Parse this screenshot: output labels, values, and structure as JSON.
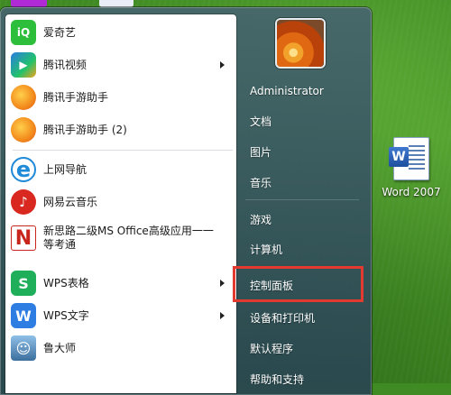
{
  "programs": [
    {
      "label": "爱奇艺",
      "icon": "iqiyi-icon",
      "color": "#2dbe3b",
      "glyph": "iQ",
      "has_submenu": false
    },
    {
      "label": "腾讯视频",
      "icon": "tencent-video-icon",
      "color": "#2a7de1",
      "glyph": "▶",
      "has_submenu": true
    },
    {
      "label": "腾讯手游助手",
      "icon": "tencent-game-assistant-icon",
      "color": "#f28a1c",
      "glyph": "◆",
      "has_submenu": false
    },
    {
      "label": "腾讯手游助手 (2)",
      "icon": "tencent-game-assistant-icon",
      "color": "#f28a1c",
      "glyph": "◆",
      "has_submenu": false
    },
    {
      "label": "上网导航",
      "icon": "ie-browser-icon",
      "color": "#1f8ad8",
      "glyph": "e",
      "has_submenu": false
    },
    {
      "label": "网易云音乐",
      "icon": "netease-music-icon",
      "color": "#d8281f",
      "glyph": "♪",
      "has_submenu": false
    },
    {
      "label": "新思路二级MS Office高级应用一一等考通",
      "icon": "exam-app-icon",
      "color": "#c8261d",
      "glyph": "N",
      "has_submenu": false
    },
    {
      "label": "WPS表格",
      "icon": "wps-sheets-icon",
      "color": "#1fae5a",
      "glyph": "S",
      "has_submenu": true
    },
    {
      "label": "WPS文字",
      "icon": "wps-writer-icon",
      "color": "#2e7de3",
      "glyph": "W",
      "has_submenu": true
    },
    {
      "label": "鲁大师",
      "icon": "ludashi-icon",
      "color": "#3d6f9d",
      "glyph": "☺",
      "has_submenu": false
    }
  ],
  "right_pane": {
    "user_name": "Administrator",
    "items": [
      "文档",
      "图片",
      "音乐",
      "游戏",
      "计算机",
      "控制面板",
      "设备和打印机",
      "默认程序",
      "帮助和支持"
    ],
    "highlighted": "控制面板",
    "highlight_color": "#e23a2e"
  },
  "desktop": {
    "icon_label": "Word 2007",
    "icon": "word-document-icon"
  }
}
